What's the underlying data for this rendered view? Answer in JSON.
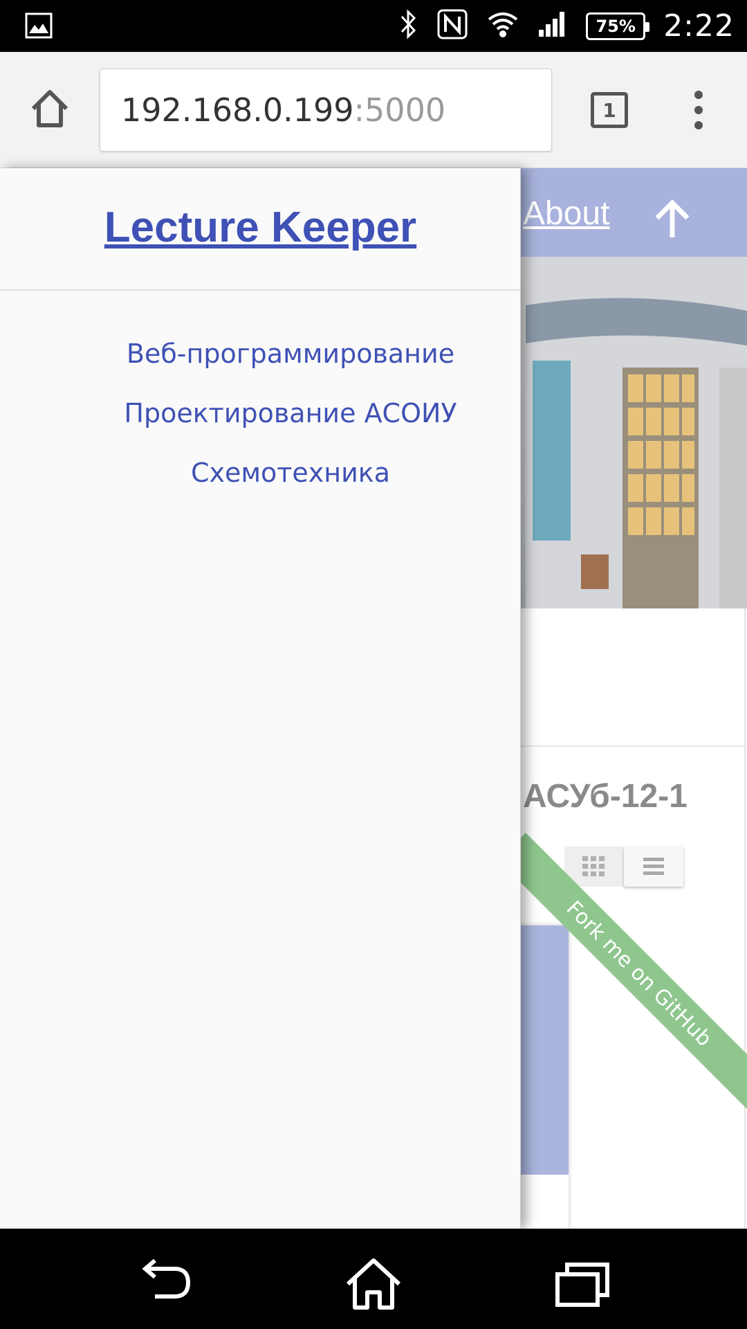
{
  "status_bar": {
    "battery": "75%",
    "time": "2:22",
    "icons": [
      "image-icon",
      "bluetooth-icon",
      "nfc-icon",
      "wifi-icon",
      "signal-icon",
      "battery-icon"
    ]
  },
  "browser": {
    "url_host": "192.168.0.199",
    "url_port": ":5000",
    "tab_count": "1",
    "icons": [
      "home-icon",
      "tabs-icon",
      "overflow-menu-icon"
    ]
  },
  "page": {
    "nav_about": "About",
    "group_title": "АСУб-12-1",
    "ribbon_text": "Fork me on GitHub",
    "colors": {
      "header": "#a8b2dc",
      "ribbon": "#8ec68e"
    }
  },
  "drawer": {
    "title": "Lecture Keeper",
    "links": [
      {
        "label": "Веб-программирование"
      },
      {
        "label": "Проектирование АСОИУ"
      },
      {
        "label": "Схемотехника"
      }
    ],
    "colors": {
      "link": "#3f51b5"
    }
  },
  "nav_bar": {
    "icons": [
      "back-icon",
      "home-icon",
      "recents-icon"
    ]
  }
}
